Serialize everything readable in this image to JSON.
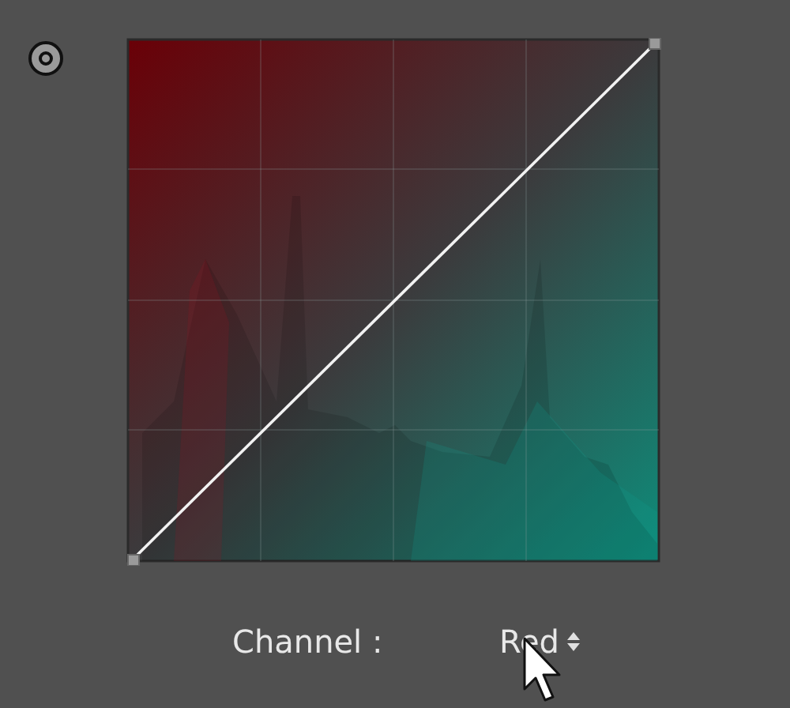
{
  "channel": {
    "label": "Channel :",
    "value": "Red"
  }
}
